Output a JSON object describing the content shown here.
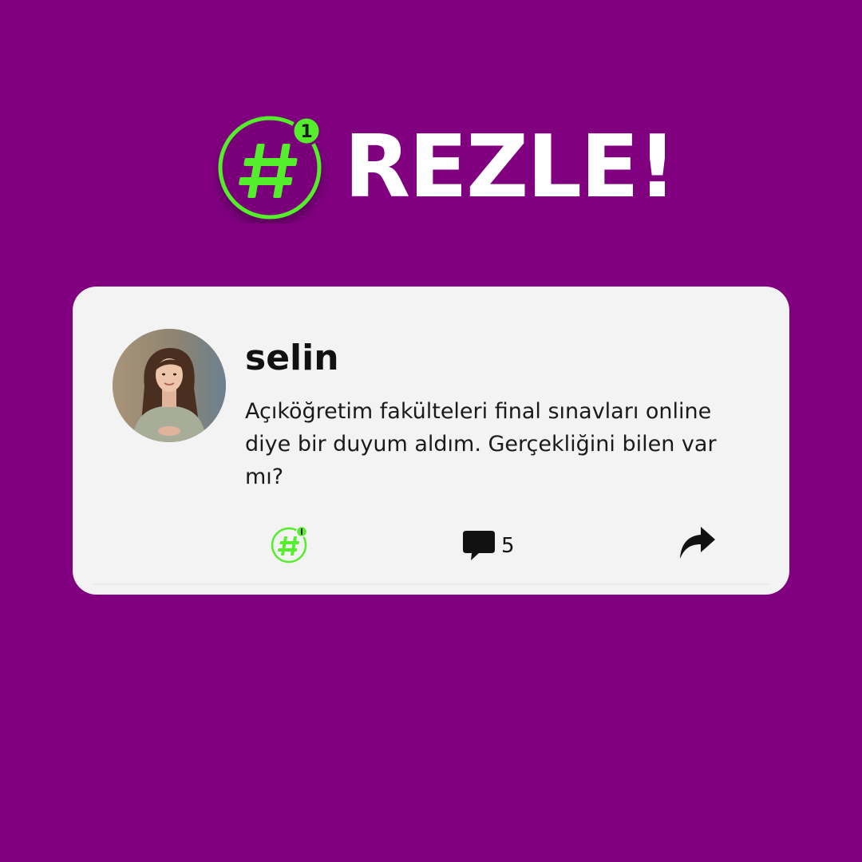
{
  "brand": {
    "title": "REZLE!",
    "logo_badge": "1",
    "logo_symbol": "#",
    "accent_color": "#55ee2c",
    "background_color": "#800080"
  },
  "post": {
    "author": "selin",
    "text": "Açıköğretim fakülteleri final sınavları online diye bir duyum aldım. Gerçekliğini bilen var mı?",
    "avatar_icon": "user-avatar-photo",
    "actions": {
      "hashtag_icon": "hashtag-badge-icon",
      "comment_icon": "speech-bubble-icon",
      "comment_count": "5",
      "share_icon": "share-arrow-icon"
    }
  }
}
